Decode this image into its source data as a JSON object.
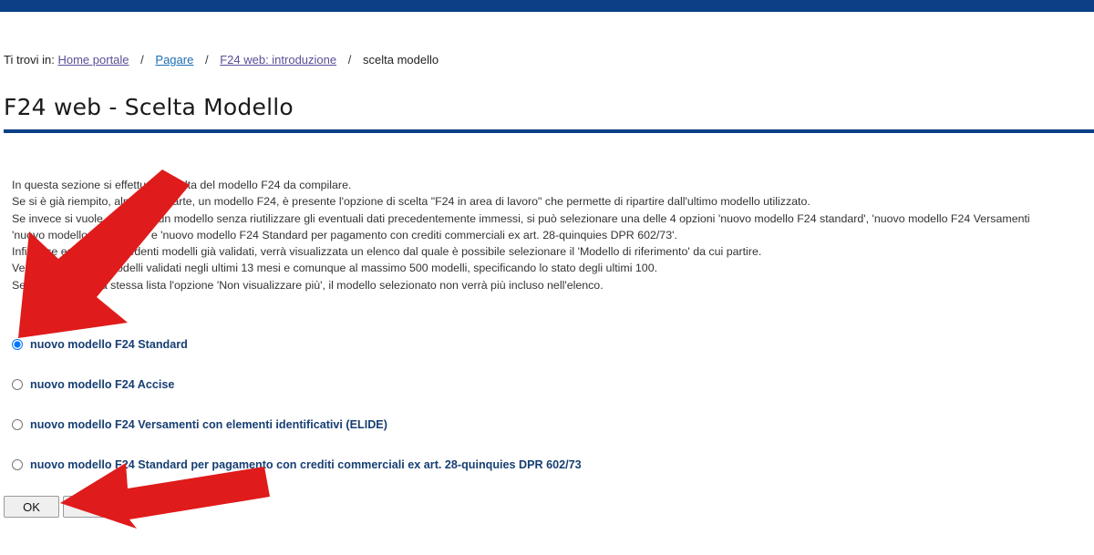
{
  "header": {
    "bar_color": "#0b3f86"
  },
  "breadcrumb": {
    "prefix": "Ti trovi in:",
    "items": [
      {
        "label": "Home portale"
      },
      {
        "label": "Pagare"
      },
      {
        "label": "F24 web: introduzione"
      }
    ],
    "current": "scelta modello",
    "separator": "/"
  },
  "page": {
    "title": "F24 web - Scelta Modello"
  },
  "intro": {
    "lines": [
      "In questa sezione si effettua la scelta del modello F24 da compilare.",
      "Se si è già riempito, almeno in parte, un modello F24, è presente l'opzione di scelta \"F24 in area di lavoro\" che permette di ripartire dall'ultimo modello utilizzato.",
      "Se invece si vuole compilare un modello senza riutilizzare gli eventuali dati precedentemente immessi, si può selezionare una delle 4 opzioni 'nuovo modello F24 standard', 'nuovo modello F24 Versamenti",
      "'nuovo modello F24 Accise' e 'nuovo modello F24 Standard per pagamento con crediti commerciali ex art. 28-quinquies DPR 602/73'.",
      "Infine, se esistono precedenti modelli già validati, verrà visualizzata un elenco dal quale è possibile selezionare il 'Modello di riferimento' da cui partire.",
      "Vengono elencati i modelli validati negli ultimi 13 mesi e comunque al massimo 500 modelli, specificando lo stato degli ultimi 100.",
      "Selezionando dalla stessa lista l'opzione 'Non visualizzare più', il modello selezionato non verrà più incluso nell'elenco."
    ]
  },
  "options": [
    {
      "label": "nuovo modello F24 Standard",
      "checked": true
    },
    {
      "label": "nuovo modello F24 Accise",
      "checked": false
    },
    {
      "label": "nuovo modello F24 Versamenti con elementi identificativi (ELIDE)",
      "checked": false
    },
    {
      "label": "nuovo modello F24 Standard per pagamento con crediti commerciali ex art. 28-quinquies DPR 602/73",
      "checked": false
    }
  ],
  "actions": {
    "ok_label": "OK"
  },
  "annotations": {
    "arrow_color": "#e01b1b"
  }
}
